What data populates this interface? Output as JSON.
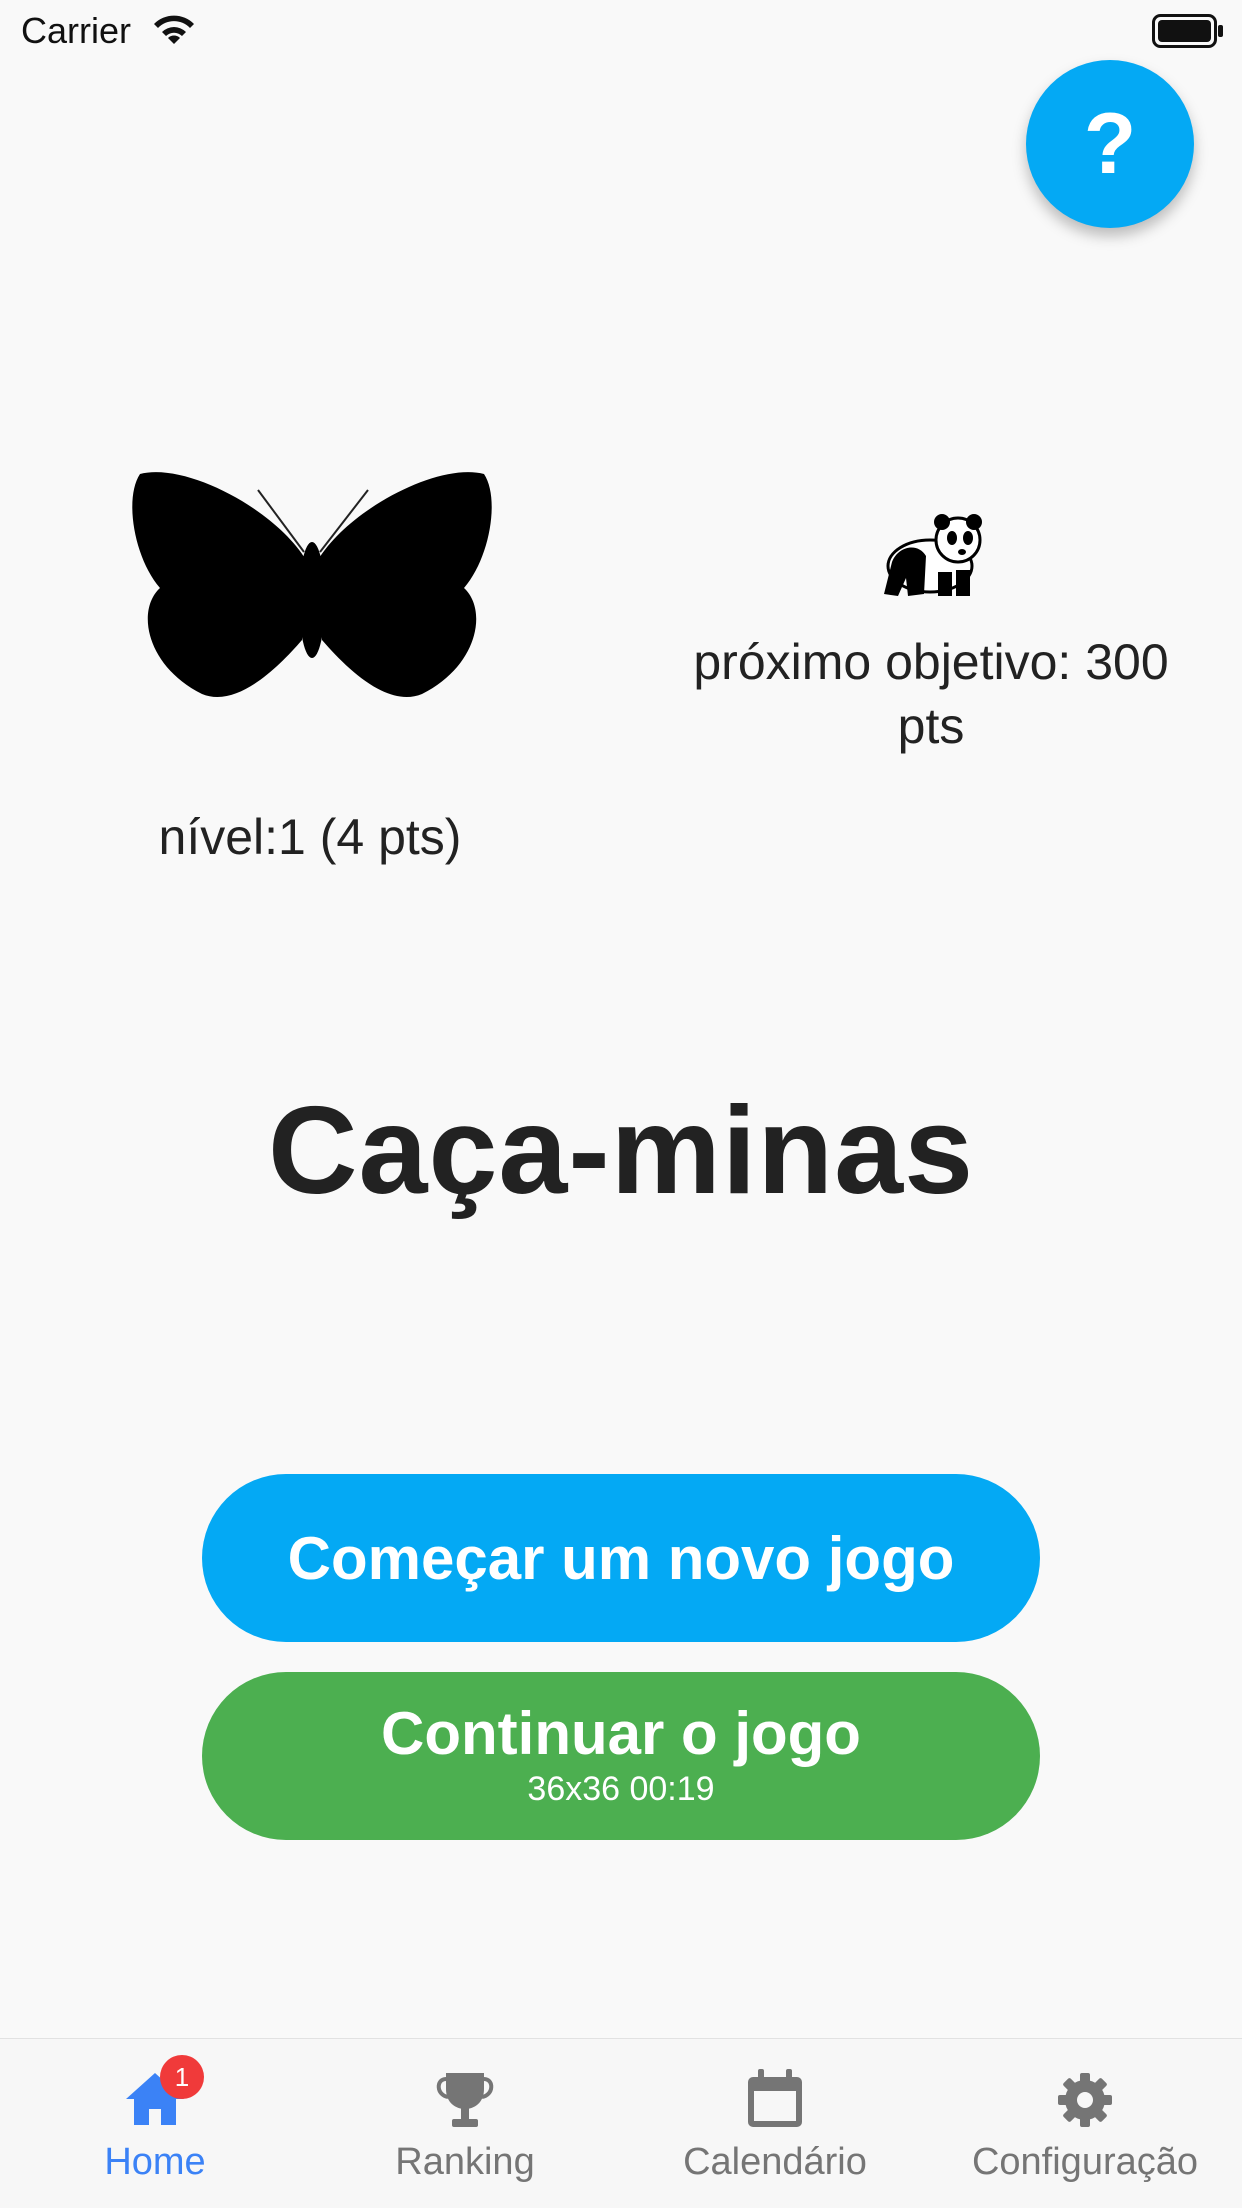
{
  "status_bar": {
    "carrier": "Carrier"
  },
  "help": {
    "label": "?"
  },
  "level": {
    "text": "nível:1 (4 pts)"
  },
  "objective": {
    "line1": "próximo objetivo: 300",
    "line2": "pts"
  },
  "title": "Caça-minas",
  "buttons": {
    "new_game": "Começar um novo jogo",
    "continue": "Continuar o jogo",
    "continue_info": "36x36 00:19"
  },
  "tabs": [
    {
      "label": "Home",
      "icon": "home-icon",
      "badge": "1"
    },
    {
      "label": "Ranking",
      "icon": "trophy-icon"
    },
    {
      "label": "Calendário",
      "icon": "calendar-icon"
    },
    {
      "label": "Configuração",
      "icon": "gear-icon"
    }
  ],
  "colors": {
    "primary_blue": "#04a9f4",
    "continue_green": "#4caf50",
    "tab_active": "#3b82f6",
    "badge_red": "#f03a3a"
  }
}
